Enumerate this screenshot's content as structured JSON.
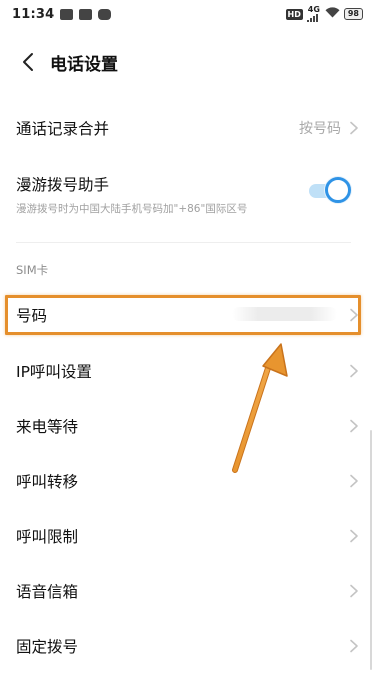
{
  "status_bar": {
    "time": "11:34",
    "hd": "HD",
    "network": "4G",
    "battery": "98",
    "left_icons": [
      "notification-icon",
      "mail-icon",
      "app-icon"
    ]
  },
  "header": {
    "back_icon": "chevron-left-icon",
    "title": "电话设置"
  },
  "settings": {
    "merge_call_log": {
      "label": "通话记录合并",
      "value": "按号码"
    },
    "roaming_assistant": {
      "label": "漫游拨号助手",
      "description": "漫游拨号时为中国大陆手机号码加\"+86\"国际区号",
      "enabled": true
    }
  },
  "sim_section": {
    "title": "SIM卡",
    "items": [
      {
        "label": "号码"
      },
      {
        "label": "IP呼叫设置"
      },
      {
        "label": "来电等待"
      },
      {
        "label": "呼叫转移"
      },
      {
        "label": "呼叫限制"
      },
      {
        "label": "语音信箱"
      },
      {
        "label": "固定拨号"
      }
    ]
  },
  "colors": {
    "accent": "#2f93e6",
    "annotation": "#e58f2c",
    "secondary_text": "#a8a8a8"
  }
}
